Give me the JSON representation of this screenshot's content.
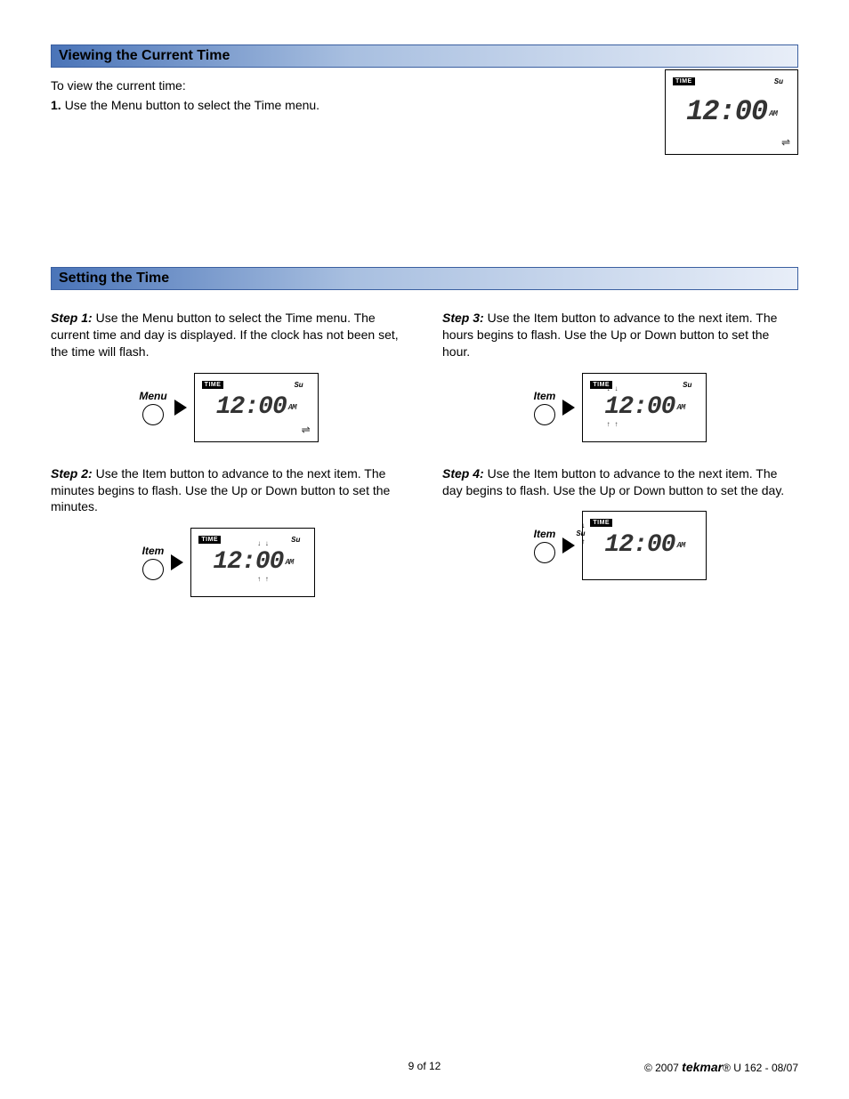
{
  "section1": {
    "title": "Viewing the Current Time",
    "intro": "To view the current time:",
    "item_num": "1.",
    "item_text": "Use the Menu button to select the Time menu."
  },
  "lcd": {
    "badge": "TIME",
    "day": "Su",
    "hours": "12",
    "sep": ":",
    "minutes": "00",
    "ampm": "AM",
    "arrow": "⇌"
  },
  "section2": {
    "title": "Setting the Time"
  },
  "steps": {
    "s1": {
      "label": "Step 1:",
      "text": " Use the Menu button to select the Time menu. The current time and day is displayed. If the clock has not been set, the time will flash.",
      "btn": "Menu"
    },
    "s2": {
      "label": "Step 2:",
      "text": " Use the Item button to advance to the next item. The minutes begins to flash. Use the Up or Down button to set the minutes.",
      "btn": "Item"
    },
    "s3": {
      "label": "Step 3:",
      "text": " Use the Item button to advance to the next item. The hours begins to flash. Use the Up or Down button to set the hour.",
      "btn": "Item"
    },
    "s4": {
      "label": "Step 4:",
      "text": " Use the Item button to advance to the next item. The day begins to flash. Use the Up or Down button to set the day.",
      "btn": "Item"
    }
  },
  "footer": {
    "page": "9 of 12",
    "copyright": "© 2007 ",
    "brand": "tekmar",
    "reg": "®",
    "code": " U 162 - 08/07"
  }
}
